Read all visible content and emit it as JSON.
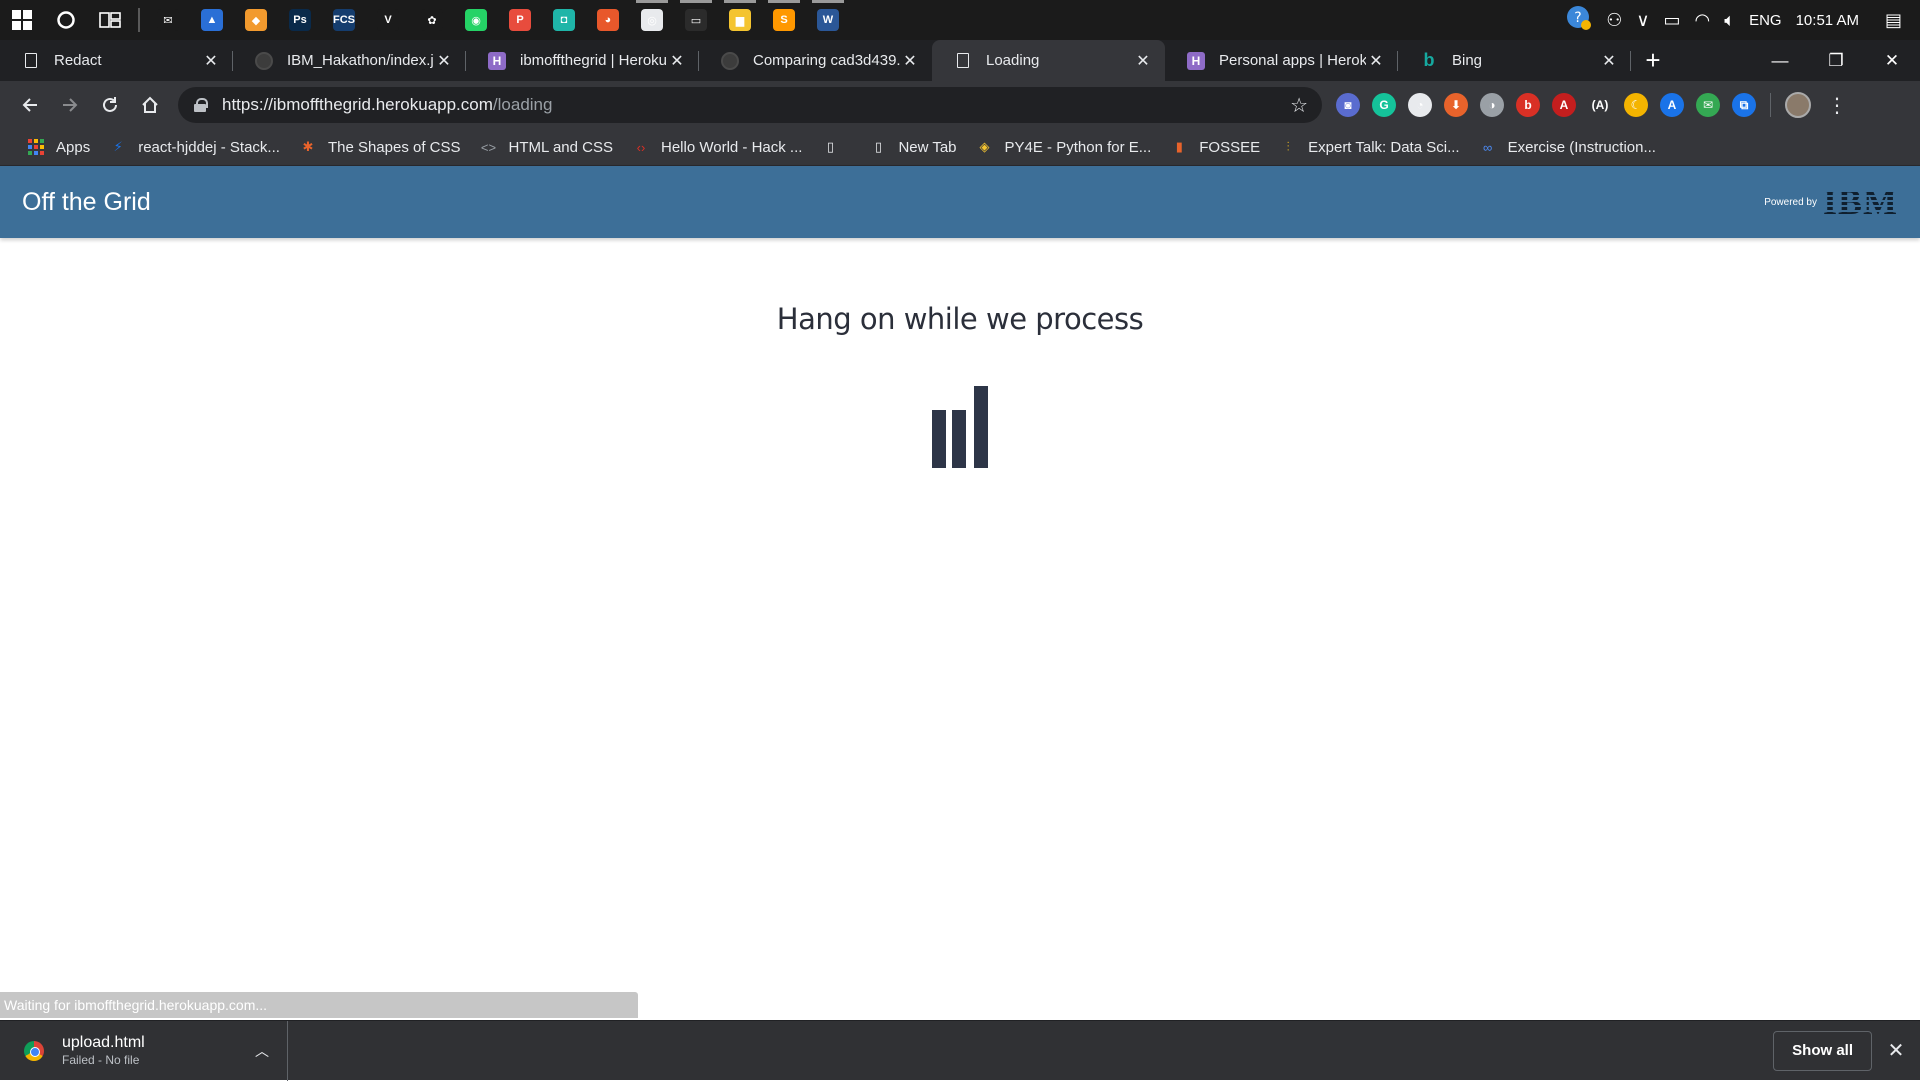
{
  "taskbar": {
    "clock": "10:51 AM",
    "language": "ENG",
    "apps": [
      {
        "icon": "mail-icon",
        "color": "#1b1b1b",
        "glyph": "✉"
      },
      {
        "icon": "photo-app-icon",
        "color": "#2a6fd6",
        "glyph": "▲"
      },
      {
        "icon": "sticky-app-icon",
        "color": "#f29a2e",
        "glyph": "◆"
      },
      {
        "icon": "photoshop-icon",
        "color": "#0a2a4a",
        "glyph": "Ps"
      },
      {
        "icon": "fcs-app-icon",
        "color": "#153d6e",
        "glyph": "FCS"
      },
      {
        "icon": "vim-app-icon",
        "color": "#1b1b1b",
        "glyph": "V"
      },
      {
        "icon": "green-app-icon",
        "color": "#1b1b1b",
        "glyph": "✿"
      },
      {
        "icon": "whatsapp-icon",
        "color": "#25d366",
        "glyph": "◉"
      },
      {
        "icon": "postman-icon",
        "color": "#e84c3d",
        "glyph": "P"
      },
      {
        "icon": "teal-app-icon",
        "color": "#1fb5a8",
        "glyph": "◘"
      },
      {
        "icon": "firefox-icon",
        "color": "#e8582b",
        "glyph": "◕"
      },
      {
        "icon": "chrome-icon",
        "color": "#e8eaed",
        "glyph": "◎"
      },
      {
        "icon": "terminal-icon",
        "color": "#2b2b2b",
        "glyph": "▭"
      },
      {
        "icon": "file-explorer-icon",
        "color": "#f4c430",
        "glyph": "▆"
      },
      {
        "icon": "sublime-icon",
        "color": "#ff9800",
        "glyph": "S"
      },
      {
        "icon": "word-icon",
        "color": "#2b5797",
        "glyph": "W"
      }
    ]
  },
  "tabs": [
    {
      "title": "Redact",
      "icon": "page"
    },
    {
      "title": "IBM_Hakathon/index.js",
      "icon": "github"
    },
    {
      "title": "ibmoffthegrid | Heroku",
      "icon": "heroku"
    },
    {
      "title": "Comparing cad3d439...",
      "icon": "github"
    },
    {
      "title": "Loading",
      "icon": "page",
      "active": true
    },
    {
      "title": "Personal apps | Heroku",
      "icon": "heroku"
    },
    {
      "title": "Bing",
      "icon": "bing"
    }
  ],
  "omnibox": {
    "url_host": "https://ibmoffthegrid.herokuapp.com",
    "url_path": "/loading"
  },
  "extensions": [
    {
      "icon": "camera-extension-icon",
      "color": "#5a6ccf",
      "glyph": "◙"
    },
    {
      "icon": "grammarly-icon",
      "color": "#15c39a",
      "glyph": "G"
    },
    {
      "icon": "speed-dial-icon",
      "color": "#e8eaed",
      "glyph": "◔"
    },
    {
      "icon": "shield-extension-icon",
      "color": "#e8632b",
      "glyph": "⬇"
    },
    {
      "icon": "compass-extension-icon",
      "color": "#9aa0a6",
      "glyph": "◑"
    },
    {
      "icon": "adblock-icon",
      "color": "#d93025",
      "glyph": "b"
    },
    {
      "icon": "acrobat-icon",
      "color": "#c41e1e",
      "glyph": "A"
    },
    {
      "icon": "translate-extension-icon",
      "color": "#35363a",
      "glyph": "(A)"
    },
    {
      "icon": "moon-extension-icon",
      "color": "#f4b400",
      "glyph": "☾"
    },
    {
      "icon": "dictionary-extension-icon",
      "color": "#1a73e8",
      "glyph": "A"
    },
    {
      "icon": "inbox-extension-icon",
      "color": "#34a853",
      "glyph": "✉"
    },
    {
      "icon": "puzzle-extension-icon",
      "color": "#1a73e8",
      "glyph": "⧉"
    }
  ],
  "bookmarks": [
    {
      "label": "Apps",
      "icon": "apps-icon"
    },
    {
      "label": "react-hjddej - Stack...",
      "icon": "lightning-icon",
      "glyph": "⚡",
      "color": "#1a73e8"
    },
    {
      "label": "The Shapes of CSS",
      "icon": "css-tricks-icon",
      "glyph": "✱",
      "color": "#e8632b"
    },
    {
      "label": "HTML and CSS",
      "icon": "code-icon",
      "glyph": "<>",
      "color": "#9aa0a6"
    },
    {
      "label": "Hello World - Hack ...",
      "icon": "hackerrank-icon",
      "glyph": "‹›",
      "color": "#d93025"
    },
    {
      "label": "",
      "icon": "page-icon",
      "glyph": "▯",
      "color": "#e8eaed"
    },
    {
      "label": "New Tab",
      "icon": "page-icon",
      "glyph": "▯",
      "color": "#e8eaed"
    },
    {
      "label": "PY4E - Python for E...",
      "icon": "python-icon",
      "glyph": "◈",
      "color": "#f4c430"
    },
    {
      "label": "FOSSEE",
      "icon": "fossee-icon",
      "glyph": "▮",
      "color": "#e8632b"
    },
    {
      "label": "Expert Talk: Data Sci...",
      "icon": "talk-icon",
      "glyph": "⫶",
      "color": "#c9a227"
    },
    {
      "label": "Exercise (Instruction...",
      "icon": "infinity-icon",
      "glyph": "∞",
      "color": "#4c8bf5"
    }
  ],
  "app": {
    "brand": "Off the Grid",
    "powered_by": "Powered by",
    "logo_text": "IBM",
    "loading_title": "Hang on while we process",
    "accent": "#3d6f98",
    "loader_color": "#2d3547"
  },
  "status_text": "Waiting for ibmoffthegrid.herokuapp.com...",
  "downloads": {
    "file_name": "upload.html",
    "file_status": "Failed - No file",
    "show_all": "Show all"
  }
}
